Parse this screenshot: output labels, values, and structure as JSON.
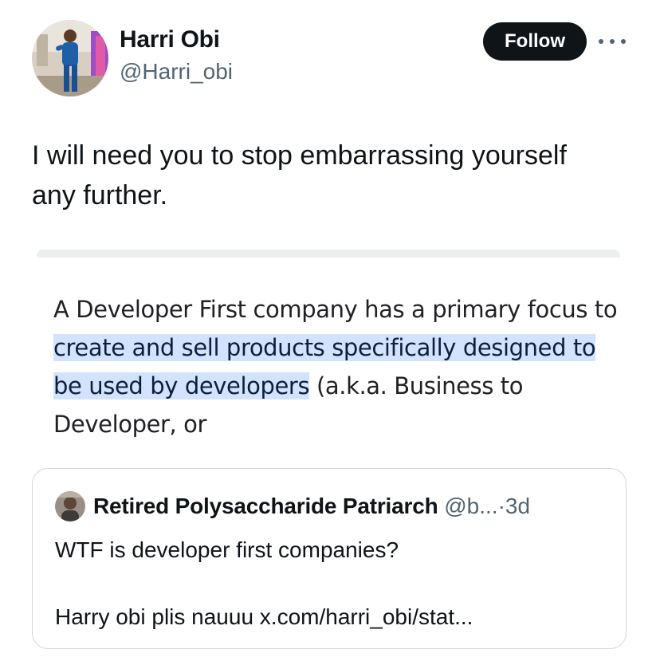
{
  "author": {
    "name": "Harri Obi",
    "handle": "@Harri_obi"
  },
  "actions": {
    "follow_label": "Follow",
    "more_icon": "more-horizontal-icon"
  },
  "post": {
    "text": "I will need you to stop embarrassing yourself\nany further."
  },
  "media": {
    "seg_plain_1": "A Developer First company has a primary focus to ",
    "seg_highlight": "create and sell products specifically designed to be used by developers",
    "seg_plain_2": " (a.k.a. Business to Developer, or",
    "highlight_color": "#d3e3fd"
  },
  "quote": {
    "name": "Retired Polysaccharide Patriarch",
    "handle": "@b...",
    "separator": "·",
    "time": "3d",
    "line1": "WTF is developer first companies?",
    "line2": "Harry obi plis nauuu x.com/harri_obi/stat..."
  },
  "colors": {
    "text": "#0f1419",
    "secondary": "#536471",
    "follow_bg": "#0f1419",
    "border": "#cfd9de"
  }
}
